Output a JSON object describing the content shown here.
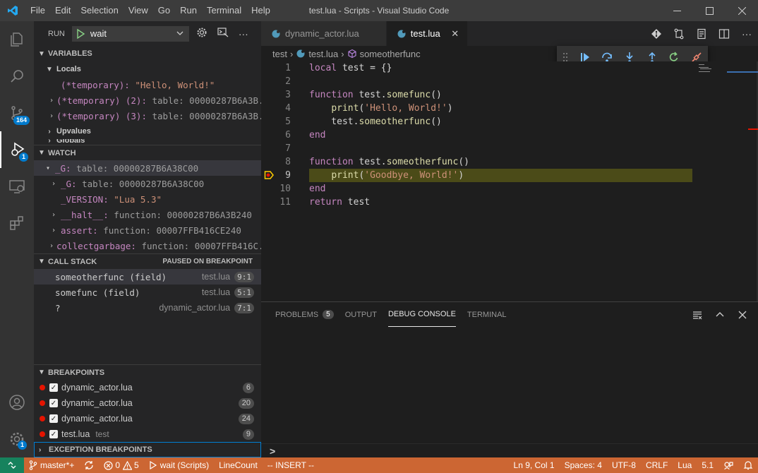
{
  "window": {
    "title": "test.lua - Scripts - Visual Studio Code",
    "menu": [
      "File",
      "Edit",
      "Selection",
      "View",
      "Go",
      "Run",
      "Terminal",
      "Help"
    ]
  },
  "activity": {
    "scm_badge": "164",
    "debug_badge": "1",
    "manage_badge": "1"
  },
  "run": {
    "label": "RUN",
    "config": "wait"
  },
  "variables": {
    "header": "VARIABLES",
    "locals_label": "Locals",
    "items": [
      {
        "name": "(*temporary):",
        "value": "\"Hello, World!\""
      },
      {
        "name": "(*temporary) (2):",
        "value": "table: 00000287B6A3B..."
      },
      {
        "name": "(*temporary) (3):",
        "value": "table: 00000287B6A3B..."
      }
    ],
    "upvalues_label": "Upvalues",
    "globals_label": "Globals"
  },
  "watch": {
    "header": "WATCH",
    "root": {
      "name": "_G:",
      "value": "table: 00000287B6A38C00"
    },
    "items": [
      {
        "name": "_G:",
        "value": "table: 00000287B6A38C00",
        "expandable": true
      },
      {
        "name": "_VERSION:",
        "value": "\"Lua 5.3\"",
        "expandable": false
      },
      {
        "name": "__halt__:",
        "value": "function: 00000287B6A3B240",
        "expandable": true
      },
      {
        "name": "assert:",
        "value": "function: 00007FFB416CE240",
        "expandable": true
      },
      {
        "name": "collectgarbage:",
        "value": "function: 00007FFB416C...",
        "expandable": true
      }
    ]
  },
  "callstack": {
    "header": "CALL STACK",
    "status": "PAUSED ON BREAKPOINT",
    "frames": [
      {
        "name": "someotherfunc (field)",
        "file": "test.lua",
        "pos": "9:1"
      },
      {
        "name": "somefunc (field)",
        "file": "test.lua",
        "pos": "5:1"
      },
      {
        "name": "?",
        "file": "dynamic_actor.lua",
        "pos": "7:1"
      }
    ]
  },
  "breakpoints": {
    "header": "BREAKPOINTS",
    "items": [
      {
        "file": "dynamic_actor.lua",
        "extra": "",
        "line": "6"
      },
      {
        "file": "dynamic_actor.lua",
        "extra": "",
        "line": "20"
      },
      {
        "file": "dynamic_actor.lua",
        "extra": "",
        "line": "24"
      },
      {
        "file": "test.lua",
        "extra": "test",
        "line": "9"
      }
    ],
    "exception_header": "EXCEPTION BREAKPOINTS"
  },
  "tabs": [
    {
      "label": "dynamic_actor.lua",
      "active": false
    },
    {
      "label": "test.lua",
      "active": true
    }
  ],
  "breadcrumb": [
    "test",
    "test.lua",
    "someotherfunc"
  ],
  "editor": {
    "current_line": 9,
    "lines": [
      {
        "n": "1",
        "tokens": [
          [
            "kw",
            "local"
          ],
          [
            "id",
            " test = {}"
          ]
        ]
      },
      {
        "n": "2",
        "tokens": []
      },
      {
        "n": "3",
        "tokens": [
          [
            "kw",
            "function"
          ],
          [
            "id",
            " test."
          ],
          [
            "fn",
            "somefunc"
          ],
          [
            "id",
            "()"
          ]
        ]
      },
      {
        "n": "4",
        "tokens": [
          [
            "id",
            "    "
          ],
          [
            "fn",
            "print"
          ],
          [
            "id",
            "("
          ],
          [
            "str",
            "'Hello, World!'"
          ],
          [
            "id",
            ")"
          ]
        ]
      },
      {
        "n": "5",
        "tokens": [
          [
            "id",
            "    test."
          ],
          [
            "fn",
            "someotherfunc"
          ],
          [
            "id",
            "()"
          ]
        ]
      },
      {
        "n": "6",
        "tokens": [
          [
            "kw",
            "end"
          ]
        ]
      },
      {
        "n": "7",
        "tokens": []
      },
      {
        "n": "8",
        "tokens": [
          [
            "kw",
            "function"
          ],
          [
            "id",
            " test."
          ],
          [
            "fn",
            "someotherfunc"
          ],
          [
            "id",
            "()"
          ]
        ]
      },
      {
        "n": "9",
        "tokens": [
          [
            "id",
            "    "
          ],
          [
            "fn",
            "print"
          ],
          [
            "id",
            "("
          ],
          [
            "str",
            "'Goodbye, World!'"
          ],
          [
            "id",
            ")"
          ]
        ]
      },
      {
        "n": "10",
        "tokens": [
          [
            "kw",
            "end"
          ]
        ]
      },
      {
        "n": "11",
        "tokens": [
          [
            "kw",
            "return"
          ],
          [
            "id",
            " test"
          ]
        ]
      }
    ]
  },
  "panel": {
    "tabs": [
      {
        "label": "PROBLEMS",
        "badge": "5",
        "active": false
      },
      {
        "label": "OUTPUT",
        "badge": "",
        "active": false
      },
      {
        "label": "DEBUG CONSOLE",
        "badge": "",
        "active": true
      },
      {
        "label": "TERMINAL",
        "badge": "",
        "active": false
      }
    ],
    "prompt": ">"
  },
  "statusbar": {
    "branch": "master*+",
    "errors": "0",
    "warnings": "5",
    "debug": "wait (Scripts)",
    "linecount": "LineCount",
    "mode": "-- INSERT --",
    "position": "Ln 9, Col 1",
    "spaces": "Spaces: 4",
    "encoding": "UTF-8",
    "eol": "CRLF",
    "language": "Lua",
    "version": "5.1"
  },
  "colors": {
    "statusbar": "#cc6633",
    "remote": "#16825d",
    "breakpoint": "#e51400",
    "current_line": "#4b4b18",
    "accent": "#007acc"
  }
}
